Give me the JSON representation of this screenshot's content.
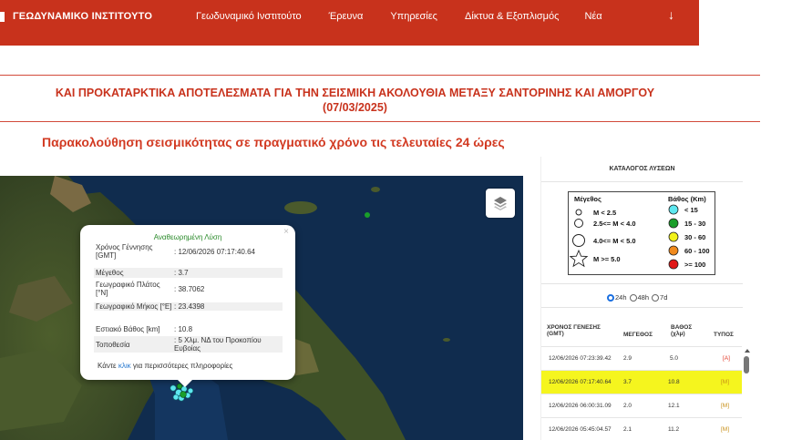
{
  "nav": {
    "brand": "ΓΕΩΔΥΝΑΜΙΚΟ ΙΝΣΤΙΤΟΥΤΟ",
    "items": [
      "Γεωδυναμικό Ινστιτούτο",
      "Έρευνα",
      "Υπηρεσίες",
      "Δίκτυα & Εξοπλισμός",
      "Νέα"
    ],
    "more_arrow": "↓",
    "color": "#c8321c"
  },
  "title": {
    "line1": "ΚΑΙ ΠΡΟΚΑΤΑΡΚΤΙΚΑ ΑΠΟΤΕΛΕΣΜΑΤΑ ΓΙΑ ΤΗΝ ΣΕΙΣΜΙΚΗ ΑΚΟΛΟΥΘΙΑ ΜΕΤΑΞΥ ΣΑΝΤΟΡΙΝΗΣ ΚΑΙ ΑΜΟΡΓΟΥ",
    "line2": "(07/03/2025)",
    "subtitle": "Παρακολούθηση σεισμικότητας σε πραγματικό χρόνο τις τελευταίες 24 ώρες"
  },
  "map": {
    "layers_icon": "layers-icon",
    "popup": {
      "close": "×",
      "title": "Αναθεωρημένη Λύση",
      "rows": [
        {
          "label": "Χρόνος Γέννησης [GMT]",
          "value": ": 12/06/2026 07:17:40.64"
        },
        {
          "label": "Μέγεθος",
          "value": ": 3.7"
        },
        {
          "label": "Γεωγραφικό Πλάτος [°N]",
          "value": ": 38.7062"
        },
        {
          "label": "Γεωγραφικό Μήκος [°E]",
          "value": ": 23.4398"
        },
        {
          "label": "Εστιακό Βάθος [km]",
          "value": ": 10.8"
        },
        {
          "label": "Τοποθεσία",
          "value": ": 5 Χλμ. ΝΔ του Προκοπίου Ευβοίας"
        }
      ],
      "footer_pre": "Κάντε ",
      "footer_link": "κλικ",
      "footer_post": " για περισσότερες πληροφορίες"
    }
  },
  "panel": {
    "title": "ΚΑΤΑΛΟΓΟΣ ΛΥΣΕΩΝ",
    "legend": {
      "mag_header": "Μέγεθος",
      "depth_header": "Βάθος (Km)",
      "mags": [
        "M < 2.5",
        "2.5<= M < 4.0",
        "4.0<= M < 5.0",
        "M >= 5.0"
      ],
      "depths": [
        {
          "label": "< 15",
          "color": "#5ee8f0"
        },
        {
          "label": "15 - 30",
          "color": "#1a9e2a"
        },
        {
          "label": "30 - 60",
          "color": "#f2f21a"
        },
        {
          "label": "60 - 100",
          "color": "#f08a1e"
        },
        {
          "label": ">= 100",
          "color": "#e01818"
        }
      ]
    },
    "filters": {
      "opt1": "24h",
      "opt2": "48h",
      "opt3": "7d",
      "selected": "24h"
    },
    "table": {
      "headers": {
        "time": "ΧΡΟΝΟΣ ΓΕΝΕΣΗΣ (GMT)",
        "mag": "ΜΕΓΕΘΟΣ",
        "depth": "ΒΑΘΟΣ (χλμ)",
        "type": "ΤΥΠΟΣ"
      },
      "rows": [
        {
          "time": "12/06/2026 07:23:39.42",
          "mag": "2.9",
          "depth": "5.0",
          "type": "[A]"
        },
        {
          "time": "12/06/2026 07:17:40.64",
          "mag": "3.7",
          "depth": "10.8",
          "type": "[M]"
        },
        {
          "time": "12/06/2026 06:00:31.09",
          "mag": "2.0",
          "depth": "12.1",
          "type": "[M]"
        },
        {
          "time": "12/06/2026 05:45:04.57",
          "mag": "2.1",
          "depth": "11.2",
          "type": "[M]"
        }
      ]
    }
  }
}
